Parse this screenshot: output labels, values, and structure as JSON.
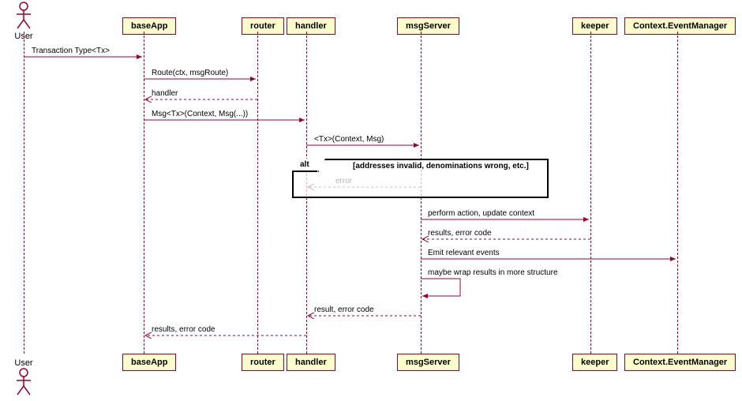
{
  "actors": {
    "user": "User"
  },
  "participants": {
    "baseApp": "baseApp",
    "router": "router",
    "handler": "handler",
    "msgServer": "msgServer",
    "keeper": "keeper",
    "eventManager": "Context.EventManager"
  },
  "messages": {
    "m1": "Transaction Type<Tx>",
    "m2": "Route(ctx, msgRoute)",
    "m3": "handler",
    "m4": "Msg<Tx>(Context, Msg(...))",
    "m5": "<Tx>(Context, Msg)",
    "m6": "error",
    "m7": "perform action, update context",
    "m8": "results, error code",
    "m9": "Emit relevant events",
    "m10": "maybe wrap results in more structure",
    "m11": "result, error code",
    "m12": "results, error code"
  },
  "alt": {
    "label": "alt",
    "condition": "[addresses invalid, denominations wrong, etc.]"
  }
}
